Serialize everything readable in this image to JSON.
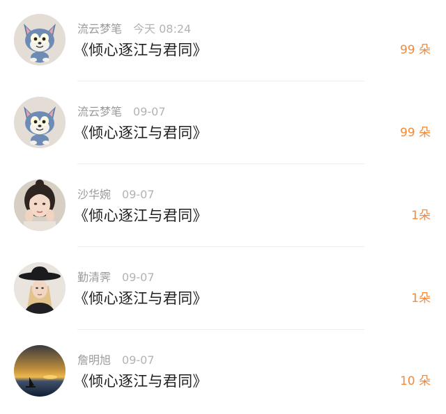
{
  "list": {
    "items": [
      {
        "name": "流云梦笔",
        "time": "今天 08:24",
        "title": "《倾心逐江与君同》",
        "count": "99 朵",
        "avatar": "cartoon-cat-avatar"
      },
      {
        "name": "流云梦笔",
        "time": "09-07",
        "title": "《倾心逐江与君同》",
        "count": "99 朵",
        "avatar": "cartoon-cat-avatar"
      },
      {
        "name": "沙华婉",
        "time": "09-07",
        "title": "《倾心逐江与君同》",
        "count": "1朵",
        "avatar": "woman-portrait-avatar"
      },
      {
        "name": "勤清霁",
        "time": "09-07",
        "title": "《倾心逐江与君同》",
        "count": "1朵",
        "avatar": "woman-hat-avatar"
      },
      {
        "name": "詹明旭",
        "time": "09-07",
        "title": "《倾心逐江与君同》",
        "count": "10 朵",
        "avatar": "sunset-sailboat-avatar"
      }
    ]
  },
  "colors": {
    "count": "#f28a3c",
    "meta": "#9a9a9a",
    "title": "#1f1f1f",
    "divider": "#eeeeee"
  }
}
